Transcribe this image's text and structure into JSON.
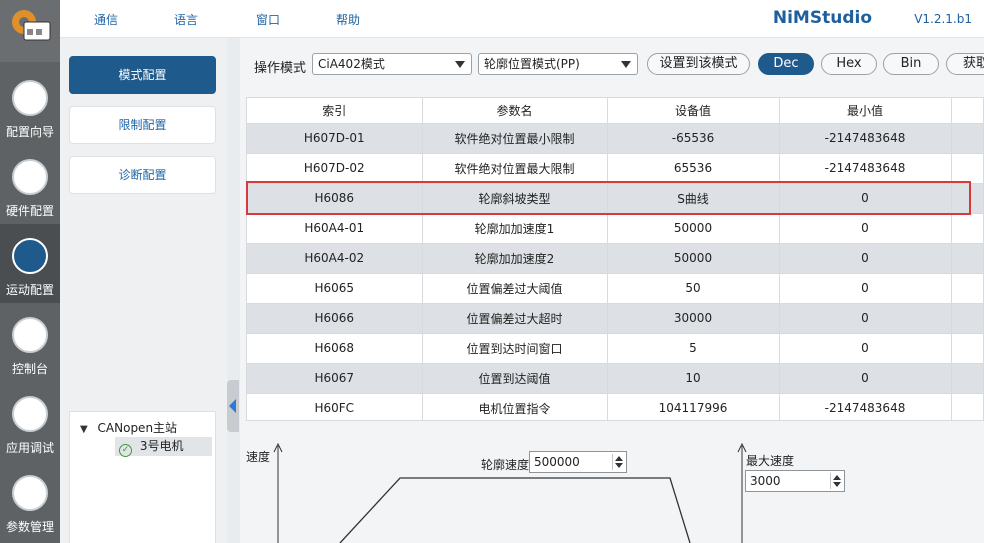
{
  "menu": [
    "通信",
    "语言",
    "窗口",
    "帮助"
  ],
  "brand": "NiMStudio",
  "version": "V1.2.1.b1",
  "rail": [
    {
      "label": "配置向导",
      "icon": "wizard-icon"
    },
    {
      "label": "硬件配置",
      "icon": "hardware-icon"
    },
    {
      "label": "运动配置",
      "icon": "motion-icon"
    },
    {
      "label": "控制台",
      "icon": "console-icon"
    },
    {
      "label": "应用调试",
      "icon": "debug-icon"
    },
    {
      "label": "参数管理",
      "icon": "params-icon"
    }
  ],
  "subnav": [
    "模式配置",
    "限制配置",
    "诊断配置"
  ],
  "tree": {
    "root": "CANopen主站",
    "child": "3号电机"
  },
  "toolbar": {
    "label": "操作模式",
    "mode_select": "CiA402模式",
    "submode_select": "轮廓位置模式(PP)",
    "set_button": "设置到该模式",
    "dec": "Dec",
    "hex": "Hex",
    "bin": "Bin",
    "fetch": "获取"
  },
  "table": {
    "headers": [
      "索引",
      "参数名",
      "设备值",
      "最小值"
    ],
    "rows": [
      [
        "H607D-01",
        "软件绝对位置最小限制",
        "-65536",
        "-2147483648"
      ],
      [
        "H607D-02",
        "软件绝对位置最大限制",
        "65536",
        "-2147483648"
      ],
      [
        "H6086",
        "轮廓斜坡类型",
        "S曲线",
        "0"
      ],
      [
        "H60A4-01",
        "轮廓加加速度1",
        "50000",
        "0"
      ],
      [
        "H60A4-02",
        "轮廓加加速度2",
        "50000",
        "0"
      ],
      [
        "H6065",
        "位置偏差过大阈值",
        "50",
        "0"
      ],
      [
        "H6066",
        "位置偏差过大超时",
        "30000",
        "0"
      ],
      [
        "H6068",
        "位置到达时间窗口",
        "5",
        "0"
      ],
      [
        "H6067",
        "位置到达阈值",
        "10",
        "0"
      ],
      [
        "H60FC",
        "电机位置指令",
        "104117996",
        "-2147483648"
      ]
    ]
  },
  "diagram": {
    "speed_axis": "速度",
    "profile_speed_label": "轮廓速度",
    "profile_speed_value": "500000",
    "max_speed_label": "最大速度",
    "max_speed_value": "3000"
  },
  "colors": {
    "accent": "#1f5a8c",
    "highlight": "#d63a3a",
    "rail": "#5e6265"
  }
}
